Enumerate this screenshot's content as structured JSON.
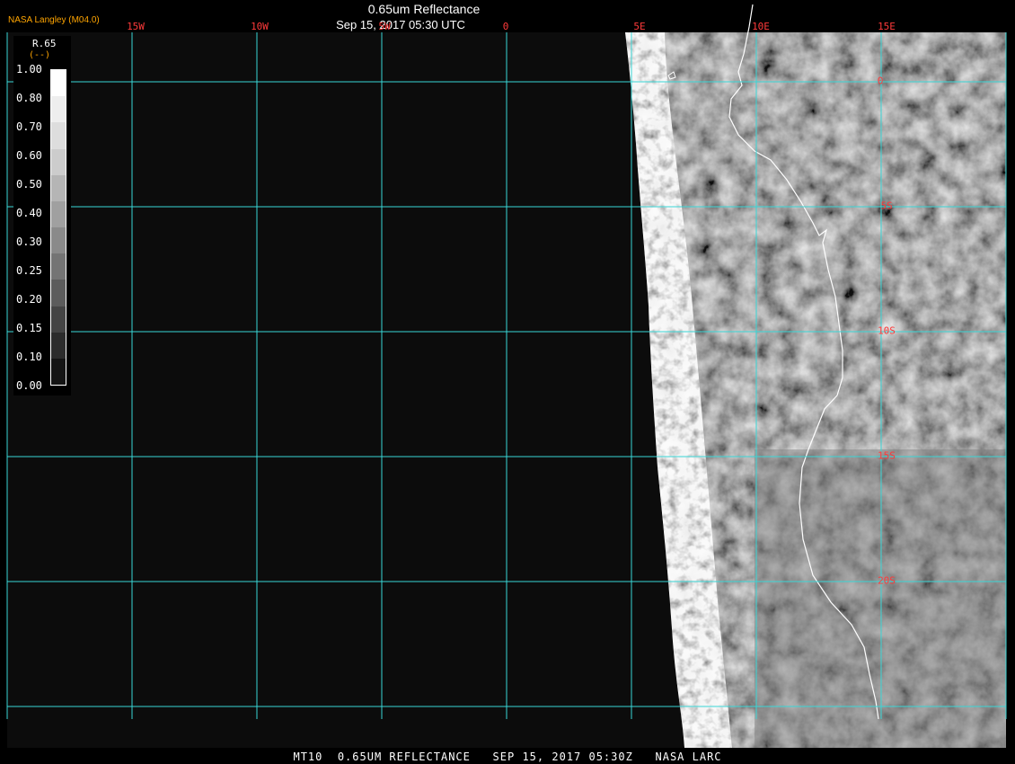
{
  "header": {
    "logo": "NASA Langley (M04.0)",
    "title": "0.65um Reflectance",
    "timestamp": "Sep 15, 2017 05:30 UTC"
  },
  "grid": {
    "lon_labels": [
      "15W",
      "10W",
      "5W",
      "0",
      "5E",
      "10E",
      "15E"
    ],
    "lat_labels": [
      "0",
      "5S",
      "10S",
      "15S",
      "20S"
    ]
  },
  "colorbar": {
    "variable": "R.65",
    "unit": "(--)",
    "ticks": [
      "1.00",
      "0.80",
      "0.70",
      "0.60",
      "0.50",
      "0.40",
      "0.30",
      "0.25",
      "0.20",
      "0.15",
      "0.10",
      "0.00"
    ],
    "colors": [
      "#ffffff",
      "#eeeeee",
      "#dddddd",
      "#cccccc",
      "#b5b5b5",
      "#a0a0a0",
      "#8a8a8a",
      "#747474",
      "#5c5c5c",
      "#444444",
      "#2c2c2c",
      "#141414"
    ]
  },
  "footer": "MT10  0.65UM REFLECTANCE   SEP 15, 2017 05:30Z   NASA LARC",
  "colors": {
    "grid_line": "#39d6d6",
    "label": "#ff3a3a",
    "logo": "#ffa500",
    "background": "#0c0c0c"
  }
}
